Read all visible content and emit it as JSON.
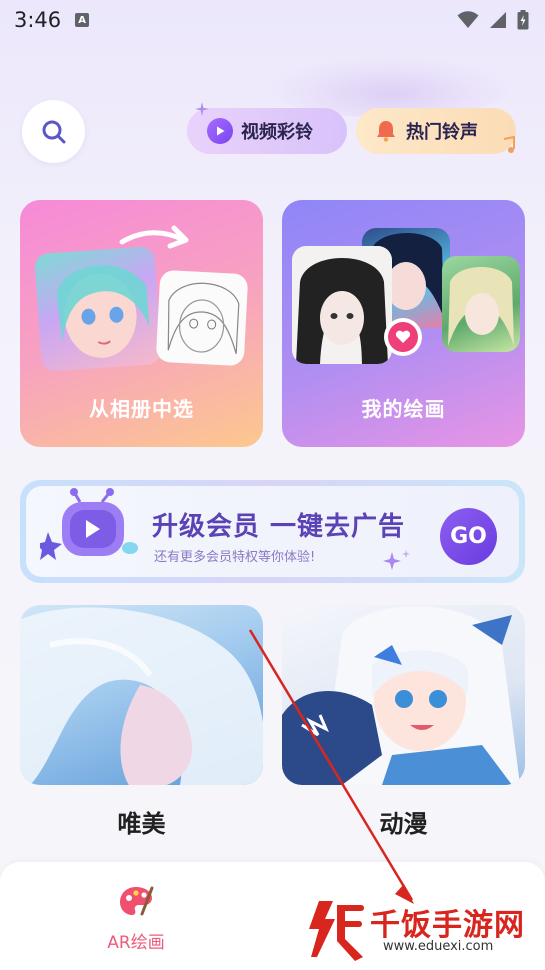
{
  "status_bar": {
    "time": "3:46"
  },
  "header": {
    "pills": [
      {
        "label": "视频彩铃",
        "icon": "play-icon"
      },
      {
        "label": "热门铃声",
        "icon": "bell-icon"
      }
    ]
  },
  "cards": {
    "album": {
      "label": "从相册中选"
    },
    "my_paintings": {
      "label": "我的绘画"
    }
  },
  "banner": {
    "title": "升级会员 一键去广告",
    "subtitle": "还有更多会员特权等你体验!",
    "go_label": "GO"
  },
  "categories": [
    {
      "label": "唯美"
    },
    {
      "label": "动漫"
    }
  ],
  "tabbar": {
    "items": [
      {
        "label": "AR绘画"
      }
    ]
  },
  "watermark": {
    "brand": "千饭手游网",
    "url": "www.eduexi.com"
  },
  "colors": {
    "accent_purple": "#6a3be0",
    "tab_active": "#ee5a7a",
    "watermark_red": "#d8261f"
  }
}
